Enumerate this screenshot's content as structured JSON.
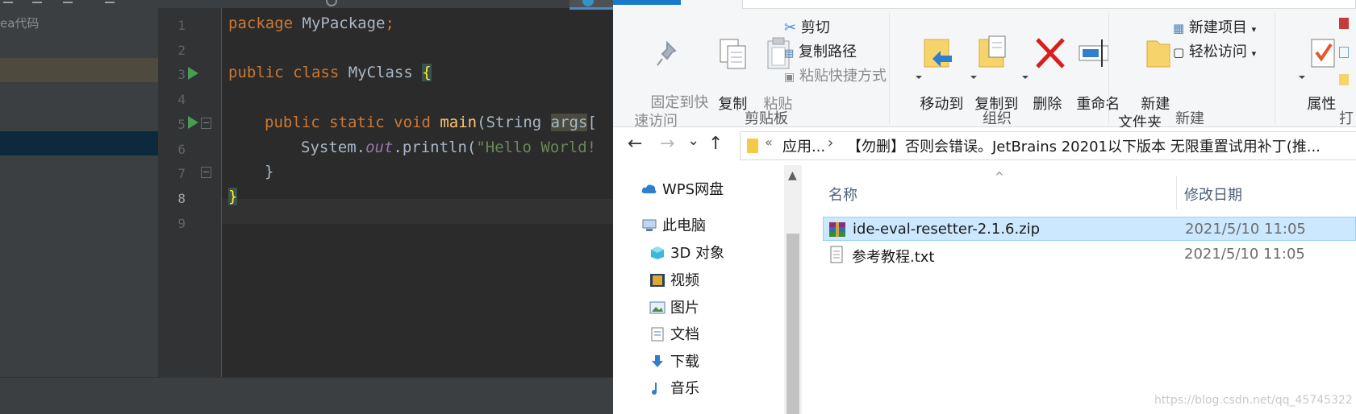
{
  "ide": {
    "project_label": "ea代码",
    "line_numbers": [
      "1",
      "2",
      "3",
      "4",
      "5",
      "6",
      "7",
      "8",
      "9"
    ],
    "code": {
      "l1_kw": "package",
      "l1_rest": " MyPackage",
      "l1_semi": ";",
      "l3_kw1": "public",
      "l3_kw2": "class",
      "l3_name": " MyClass ",
      "l3_brace": "{",
      "l5_kw": "public static void",
      "l5_fn": "main",
      "l5_paren": "(String ",
      "l5_args": "args",
      "l5_bracket": "[",
      "l6_obj": "System.",
      "l6_field": "out",
      "l6_call": ".println(",
      "l6_str": "\"Hello World!",
      "l7_brace": "}",
      "l8_brace": "}"
    }
  },
  "explorer": {
    "ribbon": {
      "pin_label": "固定到快\n速访问",
      "copy_label": "复制",
      "paste_label": "粘贴",
      "cut_label": "剪切",
      "copy_path_label": "复制路径",
      "paste_shortcut_label": "粘贴快捷方式",
      "clipboard_group": "剪贴板",
      "move_to_label": "移动到",
      "copy_to_label": "复制到",
      "delete_label": "删除",
      "rename_label": "重命名",
      "organize_group": "组织",
      "new_folder_label": "新建\n文件夹",
      "new_item_label": "新建项目",
      "easy_access_label": "轻松访问",
      "new_group": "新建",
      "properties_label": "属性",
      "open_group_partial": "打"
    },
    "nav": {
      "back": "←",
      "forward": "→",
      "recent": "⌄",
      "up": "↑",
      "address_chevron": "«",
      "address_segment1": "应用...",
      "address_separator": "›",
      "address_segment2": "【勿删】否则会错误。JetBrains 20201以下版本 无限重置试用补丁(推..."
    },
    "navpane": {
      "items": [
        {
          "label": "WPS网盘",
          "icon": "cloud-icon"
        },
        {
          "label": "此电脑",
          "icon": "computer-icon"
        },
        {
          "label": "3D 对象",
          "icon": "cube-icon"
        },
        {
          "label": "视频",
          "icon": "film-icon"
        },
        {
          "label": "图片",
          "icon": "picture-icon"
        },
        {
          "label": "文档",
          "icon": "document-icon"
        },
        {
          "label": "下载",
          "icon": "download-icon"
        },
        {
          "label": "音乐",
          "icon": "music-icon"
        }
      ]
    },
    "filelist": {
      "col_name": "名称",
      "col_date": "修改日期",
      "files": [
        {
          "name": "ide-eval-resetter-2.1.6.zip",
          "date": "2021/5/10 11:05",
          "icon": "zip-archive-icon",
          "selected": true
        },
        {
          "name": "参考教程.txt",
          "date": "2021/5/10 11:05",
          "icon": "text-file-icon",
          "selected": false
        }
      ]
    }
  },
  "watermark": "https://blog.csdn.net/qq_45745322",
  "colors": {
    "ide_bg": "#2b2b2b",
    "keyword": "#cc7832",
    "function": "#ffc66d",
    "string": "#6a8759",
    "selection_blue": "#cce8ff",
    "file_tab_blue": "#1979ca"
  }
}
